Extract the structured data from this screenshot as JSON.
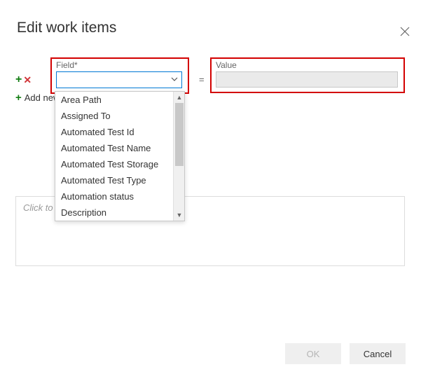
{
  "dialog": {
    "title": "Edit work items",
    "close_icon": "close"
  },
  "row": {
    "field_label": "Field*",
    "field_value": "",
    "equals": "=",
    "value_label": "Value",
    "value_value": ""
  },
  "add_link": "Add new clause",
  "dropdown": {
    "items": [
      "Area Path",
      "Assigned To",
      "Automated Test Id",
      "Automated Test Name",
      "Automated Test Storage",
      "Automated Test Type",
      "Automation status",
      "Description"
    ]
  },
  "notes": {
    "placeholder": "Click to"
  },
  "buttons": {
    "ok": "OK",
    "cancel": "Cancel"
  }
}
